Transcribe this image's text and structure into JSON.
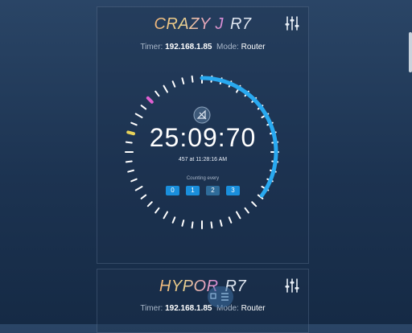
{
  "device1": {
    "name": "CRAZY J",
    "model": "R7",
    "timer_label": "Timer:",
    "ip": "192.168.1.85",
    "mode_label": "Mode:",
    "mode": "Router",
    "time": "25:09:70",
    "subtitle": "457 at 11:28:16 AM",
    "counting_label": "Counting every",
    "options": [
      "0",
      "1",
      "2",
      "3"
    ],
    "progress_fraction": 0.35,
    "selected_option": "2"
  },
  "device2": {
    "name": "HYPOR",
    "model": "R7",
    "timer_label": "Timer:",
    "ip": "192.168.1.85",
    "mode_label": "Mode:",
    "mode": "Router"
  },
  "colors": {
    "accent": "#29a9f0",
    "tick_pink": "#e060d0",
    "tick_yellow": "#e8d25a"
  }
}
